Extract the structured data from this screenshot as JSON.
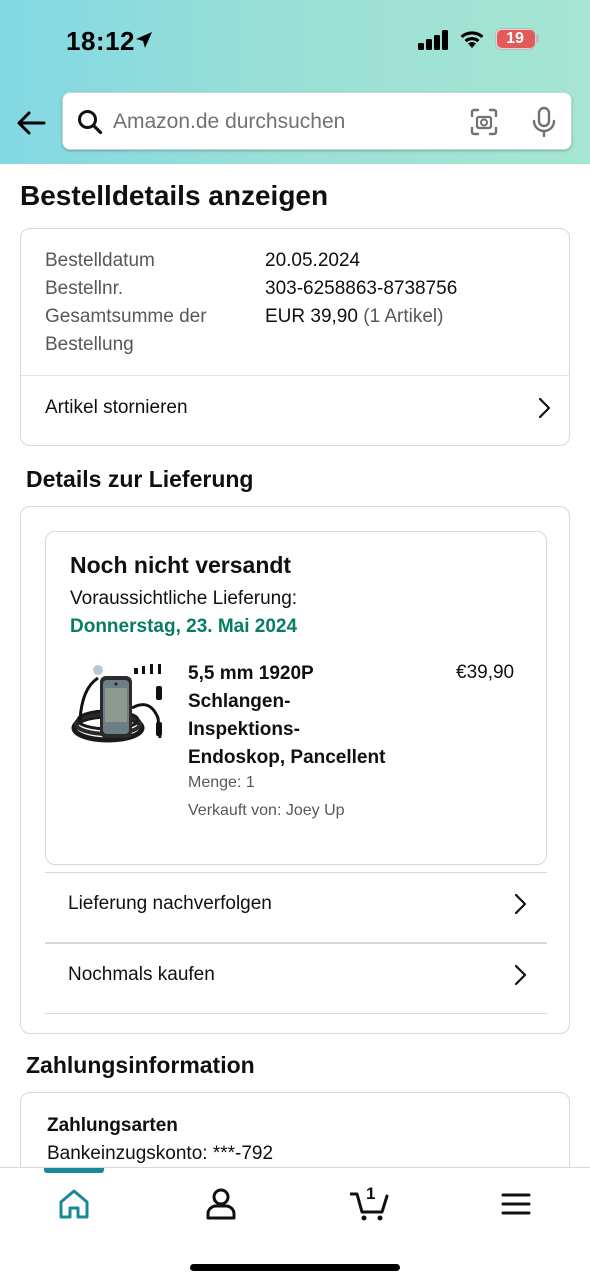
{
  "status_bar": {
    "time": "18:12",
    "battery": "19"
  },
  "search": {
    "placeholder": "Amazon.de durchsuchen"
  },
  "page_title": "Bestelldetails anzeigen",
  "order_summary": {
    "rows": [
      {
        "label": "Bestelldatum",
        "value": "20.05.2024"
      },
      {
        "label": "Bestellnr.",
        "value": "303-6258863-8738756"
      },
      {
        "label_line1": "Gesamtsumme der",
        "label_line2": "Bestellung",
        "value": "EUR 39,90",
        "value_suffix": "(1 Artikel)"
      }
    ],
    "cancel_label": "Artikel stornieren"
  },
  "delivery": {
    "section_title": "Details zur Lieferung",
    "status": "Noch nicht versandt",
    "eta_label": "Voraussichtliche Lieferung:",
    "eta_date": "Donnerstag, 23. Mai 2024",
    "product": {
      "title_lines": [
        "5,5 mm 1920P",
        "Schlangen-",
        "Inspektions-",
        "Endoskop, Pancellent"
      ],
      "price": "€39,90",
      "quantity": "Menge: 1",
      "seller": "Verkauft von: Joey Up"
    },
    "track_label": "Lieferung nachverfolgen",
    "buy_again_label": "Nochmals kaufen"
  },
  "payment": {
    "section_title": "Zahlungsinformation",
    "method_title": "Zahlungsarten",
    "method_value": "Bankeinzugskonto: ***-792"
  },
  "nav": {
    "cart_count": "1",
    "active_color": "#188999"
  },
  "colors": {
    "delivery_green": "#067d62",
    "header_gradient_start": "#82d8e3",
    "header_gradient_end": "#a6e5d1"
  }
}
